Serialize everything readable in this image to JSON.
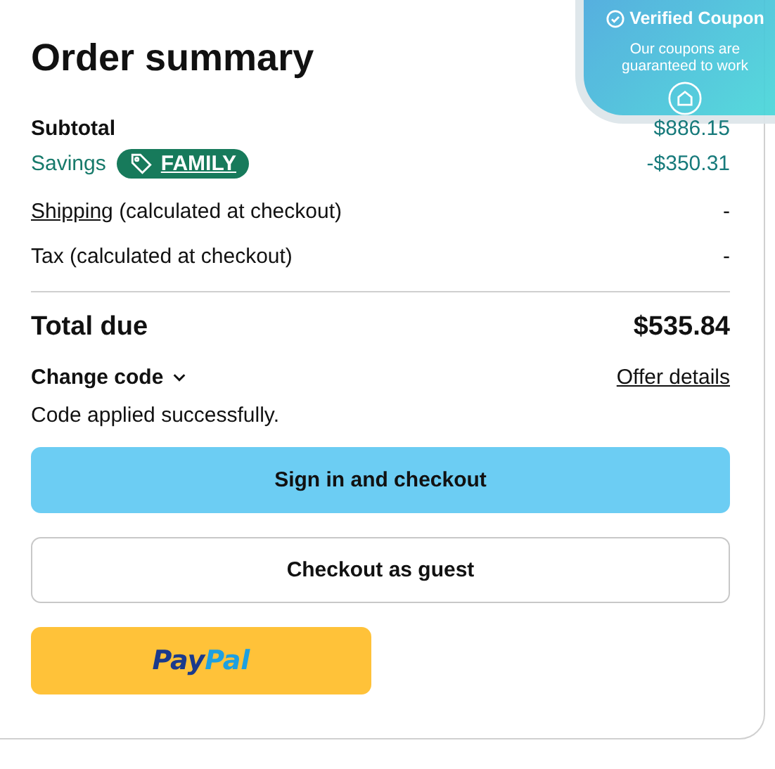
{
  "title": "Order summary",
  "lines": [
    {
      "kind": "subtotal",
      "label": "Subtotal",
      "value": "$886.15"
    },
    {
      "kind": "savings",
      "label": "Savings",
      "code": "FAMILY",
      "value": "-$350.31"
    },
    {
      "kind": "link",
      "label": "Shipping",
      "note": "(calculated at checkout)",
      "value": "-"
    },
    {
      "kind": "plain",
      "label": "Tax (calculated at checkout)",
      "value": "-"
    }
  ],
  "total": {
    "label": "Total due",
    "value": "$535.84"
  },
  "change_code": {
    "label": "Change code",
    "expanded": false
  },
  "offer_link": "Offer details",
  "status": "Code applied successfully.",
  "buttons": [
    {
      "kind": "primary",
      "label": "Sign in and checkout"
    },
    {
      "kind": "outline",
      "label": "Checkout as guest"
    }
  ],
  "paypal": {
    "part_1": "Pay",
    "part_2": "Pal"
  },
  "badge": {
    "title": "Verified Coupon",
    "text": "Our coupons are guaranteed to work"
  }
}
